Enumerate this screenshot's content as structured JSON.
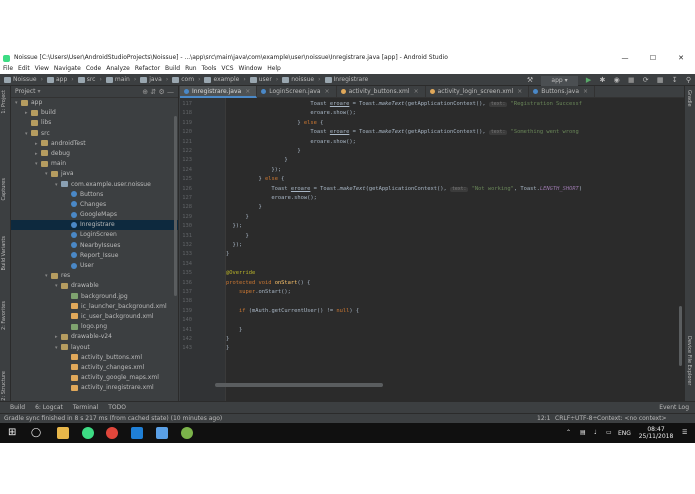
{
  "window": {
    "title": "Noissue [C:\\Users\\User\\AndroidStudioProjects\\Noissue] - ...\\app\\src\\main\\java\\com\\example\\user\\noissue\\Inregistrare.java [app] - Android Studio",
    "minimize": "—",
    "maximize": "☐",
    "close": "✕"
  },
  "menu": [
    "File",
    "Edit",
    "View",
    "Navigate",
    "Code",
    "Analyze",
    "Refactor",
    "Build",
    "Run",
    "Tools",
    "VCS",
    "Window",
    "Help"
  ],
  "breadcrumbs": [
    "Noissue",
    "app",
    "src",
    "main",
    "java",
    "com",
    "example",
    "user",
    "noissue",
    "Inregistrare"
  ],
  "run_config": "app",
  "project_panel": {
    "title": "Project",
    "tree": [
      {
        "label": "app",
        "depth": 0,
        "icon": "folder",
        "arrow": "▾"
      },
      {
        "label": "build",
        "depth": 1,
        "icon": "folder",
        "arrow": "▸"
      },
      {
        "label": "libs",
        "depth": 1,
        "icon": "folder",
        "arrow": ""
      },
      {
        "label": "src",
        "depth": 1,
        "icon": "folder",
        "arrow": "▾"
      },
      {
        "label": "androidTest",
        "depth": 2,
        "icon": "folder",
        "arrow": "▸"
      },
      {
        "label": "debug",
        "depth": 2,
        "icon": "folder",
        "arrow": "▸"
      },
      {
        "label": "main",
        "depth": 2,
        "icon": "folder",
        "arrow": "▾"
      },
      {
        "label": "java",
        "depth": 3,
        "icon": "folder",
        "arrow": "▾"
      },
      {
        "label": "com.example.user.noissue",
        "depth": 4,
        "icon": "pkg",
        "arrow": "▾"
      },
      {
        "label": "Buttons",
        "depth": 5,
        "icon": "classc",
        "arrow": ""
      },
      {
        "label": "Changes",
        "depth": 5,
        "icon": "classc",
        "arrow": ""
      },
      {
        "label": "GoogleMaps",
        "depth": 5,
        "icon": "classc",
        "arrow": ""
      },
      {
        "label": "Inregistrare",
        "depth": 5,
        "icon": "classc",
        "arrow": "",
        "selected": true
      },
      {
        "label": "LoginScreen",
        "depth": 5,
        "icon": "classc",
        "arrow": ""
      },
      {
        "label": "NearbyIssues",
        "depth": 5,
        "icon": "classc",
        "arrow": ""
      },
      {
        "label": "Report_Issue",
        "depth": 5,
        "icon": "classc",
        "arrow": ""
      },
      {
        "label": "User",
        "depth": 5,
        "icon": "classc",
        "arrow": ""
      },
      {
        "label": "res",
        "depth": 3,
        "icon": "folder",
        "arrow": "▾"
      },
      {
        "label": "drawable",
        "depth": 4,
        "icon": "folder",
        "arrow": "▾"
      },
      {
        "label": "background.jpg",
        "depth": 5,
        "icon": "img",
        "arrow": ""
      },
      {
        "label": "ic_launcher_background.xml",
        "depth": 5,
        "icon": "xml",
        "arrow": ""
      },
      {
        "label": "ic_user_background.xml",
        "depth": 5,
        "icon": "xml",
        "arrow": ""
      },
      {
        "label": "logo.png",
        "depth": 5,
        "icon": "img",
        "arrow": ""
      },
      {
        "label": "drawable-v24",
        "depth": 4,
        "icon": "folder",
        "arrow": "▸"
      },
      {
        "label": "layout",
        "depth": 4,
        "icon": "folder",
        "arrow": "▾"
      },
      {
        "label": "activity_buttons.xml",
        "depth": 5,
        "icon": "xml",
        "arrow": ""
      },
      {
        "label": "activity_changes.xml",
        "depth": 5,
        "icon": "xml",
        "arrow": ""
      },
      {
        "label": "activity_google_maps.xml",
        "depth": 5,
        "icon": "xml",
        "arrow": ""
      },
      {
        "label": "activity_inregistrare.xml",
        "depth": 5,
        "icon": "xml",
        "arrow": ""
      }
    ]
  },
  "left_tool_tabs": [
    "1: Project",
    "Captures",
    "Build Variants",
    "2: Favorites",
    "2: Structure"
  ],
  "right_tool_tabs": [
    "Gradle",
    "Device File Explorer"
  ],
  "editor_tabs": [
    {
      "label": "Inregistrare.java",
      "active": true
    },
    {
      "label": "LoginScreen.java",
      "active": false
    },
    {
      "label": "activity_buttons.xml",
      "active": false
    },
    {
      "label": "activity_login_screen.xml",
      "active": false
    },
    {
      "label": "Buttons.java",
      "active": false
    }
  ],
  "code_lines": [
    {
      "n": "117",
      "html": "                          Toast <span class='tok-ul'>eroare</span> = Toast.<i>makeText</i>(getApplicationContext(), <span class='tok-hint'>text:</span> <span class='tok-str'>\"Registration Successf</span>"
    },
    {
      "n": "118",
      "html": "                          eroare.show();"
    },
    {
      "n": "119",
      "html": "                      } <span class='tok-kw'>else</span> {"
    },
    {
      "n": "120",
      "html": "                          Toast <span class='tok-ul'>eroare</span> = Toast.<i>makeText</i>(getApplicationContext(), <span class='tok-hint'>text:</span> <span class='tok-str'>\"Something went wrong</span>"
    },
    {
      "n": "121",
      "html": "                          eroare.show();"
    },
    {
      "n": "122",
      "html": "                      }"
    },
    {
      "n": "123",
      "html": "                  }"
    },
    {
      "n": "124",
      "html": "              });"
    },
    {
      "n": "125",
      "html": "          } <span class='tok-kw'>else</span> {"
    },
    {
      "n": "126",
      "html": "              Toast <span class='tok-ul'>eroare</span> = Toast.<i>makeText</i>(getApplicationContext(), <span class='tok-hint'>text:</span> <span class='tok-str'>\"Not working\"</span>, Toast.<span class='tok-fld'>LENGTH_SHORT</span>)"
    },
    {
      "n": "127",
      "html": "              eroare.show();"
    },
    {
      "n": "128",
      "html": "          }"
    },
    {
      "n": "129",
      "html": "      }"
    },
    {
      "n": "130",
      "html": "  });"
    },
    {
      "n": "131",
      "html": "      }"
    },
    {
      "n": "132",
      "html": "  });"
    },
    {
      "n": "133",
      "html": "}"
    },
    {
      "n": "134",
      "html": ""
    },
    {
      "n": "135",
      "html": "<span class='tok-ann'>@Override</span>"
    },
    {
      "n": "136",
      "html": "<span class='tok-kw'>protected void</span> <span class='tok-fn'>onStart</span>() {"
    },
    {
      "n": "137",
      "html": "    <span class='tok-kw'>super</span>.onStart();"
    },
    {
      "n": "138",
      "html": ""
    },
    {
      "n": "139",
      "html": "    <span class='tok-kw'>if</span> (mAuth.getCurrentUser() != <span class='tok-kw'>null</span>) {"
    },
    {
      "n": "140",
      "html": ""
    },
    {
      "n": "141",
      "html": "    }"
    },
    {
      "n": "142",
      "html": "}"
    },
    {
      "n": "143",
      "html": "}"
    }
  ],
  "bottom_tools": [
    "Build",
    "6: Logcat",
    "Terminal",
    "TODO",
    "Event Log"
  ],
  "status": {
    "message": "Gradle sync finished in 8 s 217 ms (from cached state) (10 minutes ago)",
    "position": "12:1",
    "line_sep": "CRLF÷",
    "encoding": "UTF-8÷",
    "context": "Context: <no context>"
  },
  "taskbar": {
    "time": "08:47",
    "date": "25/11/2018",
    "lang": "ENG"
  },
  "colors": {
    "ide_bg": "#3c3f41",
    "editor_bg": "#2b2b2b",
    "selection": "#0d293e",
    "accent": "#4a88c7"
  }
}
